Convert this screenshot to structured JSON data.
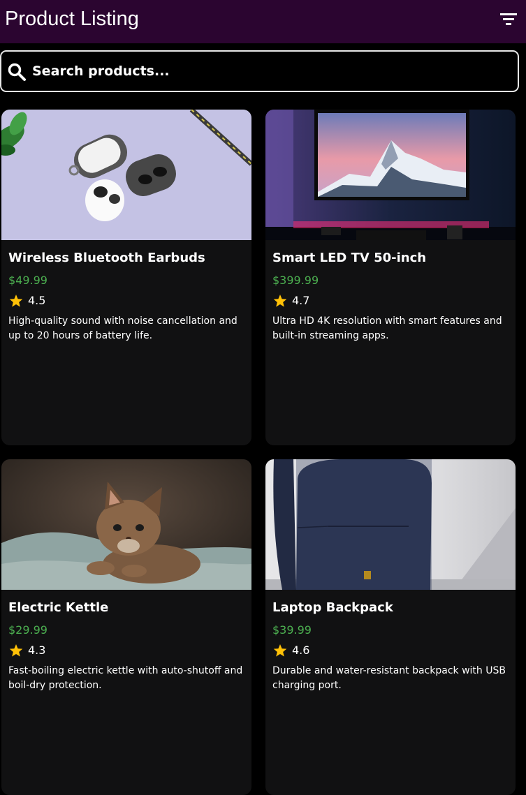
{
  "app_bar": {
    "title": "Product Listing",
    "filter_icon": "filter-list-icon",
    "background": "#2b0530"
  },
  "search": {
    "placeholder": "Search products...",
    "value": "",
    "icon": "search-icon"
  },
  "colors": {
    "price": "#4caf50",
    "star": "#ffc107",
    "card_background": "#111112"
  },
  "products": [
    {
      "name": "Wireless Bluetooth Earbuds",
      "price": "$49.99",
      "rating": "4.5",
      "description": "High-quality sound with noise cancellation and up to 20 hours of battery life."
    },
    {
      "name": "Smart LED TV 50-inch",
      "price": "$399.99",
      "rating": "4.7",
      "description": "Ultra HD 4K resolution with smart features and built-in streaming apps."
    },
    {
      "name": "Electric Kettle",
      "price": "$29.99",
      "rating": "4.3",
      "description": "Fast-boiling electric kettle with auto-shutoff and boil-dry protection."
    },
    {
      "name": "Laptop Backpack",
      "price": "$39.99",
      "rating": "4.6",
      "description": "Durable and water-resistant backpack with USB charging port."
    }
  ]
}
